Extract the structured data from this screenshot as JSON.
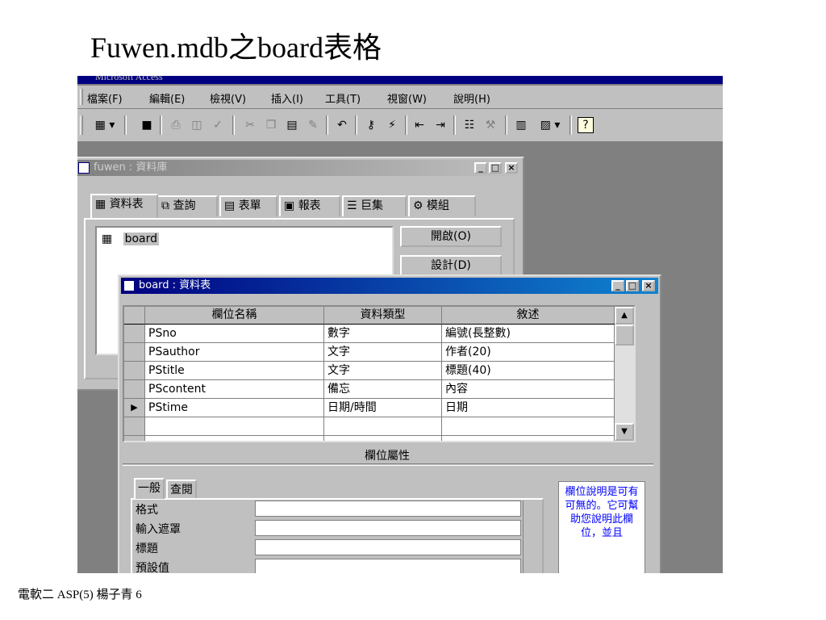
{
  "slide": {
    "title": "Fuwen.mdb之board表格",
    "footer": "電軟二 ASP(5) 楊子青 6"
  },
  "app": {
    "title": "Microsoft Access",
    "menu": [
      "檔案(F)",
      "編輯(E)",
      "檢視(V)",
      "插入(I)",
      "工具(T)",
      "視窗(W)",
      "說明(H)"
    ]
  },
  "toolbar": {
    "icons": [
      "view-icon",
      "save-icon",
      "print-icon",
      "print-preview-icon",
      "spelling-icon",
      "cut-icon",
      "copy-icon",
      "paste-icon",
      "format-painter-icon",
      "undo-icon",
      "primary-key-icon",
      "indexes-icon",
      "insert-rows-icon",
      "delete-rows-icon",
      "properties-icon",
      "build-icon",
      "database-window-icon",
      "new-object-icon",
      "help-icon"
    ]
  },
  "db_window": {
    "title": "fuwen : 資料庫",
    "tabs": [
      "資料表",
      "查詢",
      "表單",
      "報表",
      "巨集",
      "模組"
    ],
    "objects": [
      "board"
    ],
    "buttons": [
      "開啟(O)",
      "設計(D)"
    ]
  },
  "table_window": {
    "title": "board : 資料表",
    "columns": [
      "欄位名稱",
      "資料類型",
      "敘述"
    ],
    "rows": [
      [
        "PSno",
        "數字",
        "編號(長整數)"
      ],
      [
        "PSauthor",
        "文字",
        "作者(20)"
      ],
      [
        "PStitle",
        "文字",
        "標題(40)"
      ],
      [
        "PScontent",
        "備忘",
        "內容"
      ],
      [
        "PStime",
        "日期/時間",
        "日期"
      ],
      [
        "",
        "",
        ""
      ],
      [
        "",
        "",
        ""
      ]
    ],
    "current_row_marker": "▶",
    "field_properties_label": "欄位屬性",
    "property_tabs": [
      "一般",
      "查閱"
    ],
    "properties": [
      "格式",
      "輸入遮罩",
      "標題",
      "預設值"
    ],
    "help_text": "欄位說明是可有可無的。它可幫助您說明此欄位，並且"
  },
  "colors": {
    "active_title": "#000080",
    "inactive_title": "#808080",
    "help_text": "#0000ff",
    "face": "#c0c0c0"
  }
}
